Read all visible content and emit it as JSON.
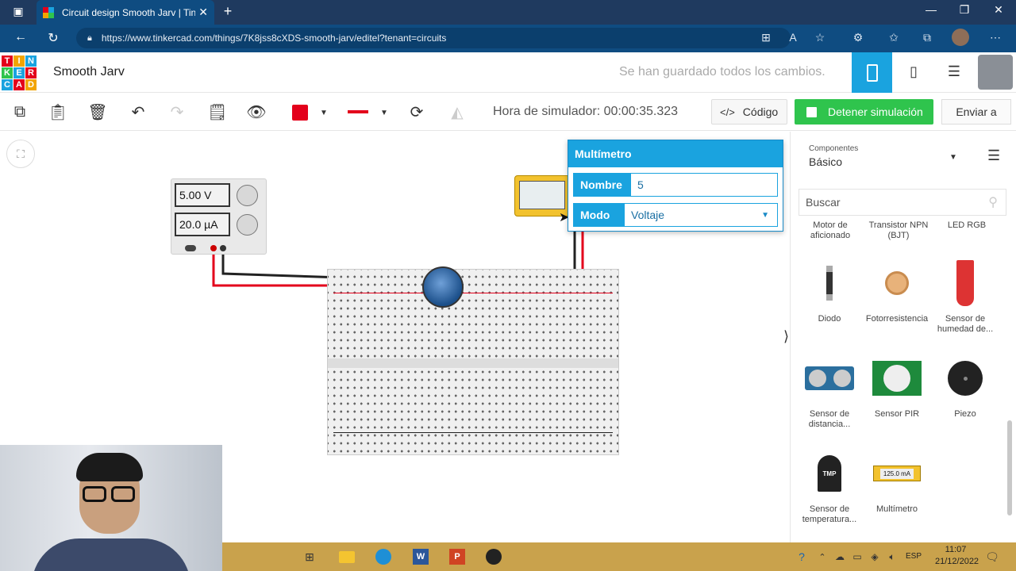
{
  "browser": {
    "tab_title": "Circuit design Smooth Jarv | Tinkercad",
    "url": "https://www.tinkercad.com/things/7K8jss8cXDS-smooth-jarv/editel?tenant=circuits"
  },
  "header": {
    "logo_letters": [
      "TIN",
      "KER",
      "CAD"
    ],
    "project_name": "Smooth Jarv",
    "save_status": "Se han guardado todos los cambios."
  },
  "toolbar": {
    "sim_time": "Hora de simulador: 00:00:35.323",
    "code_label": "Código",
    "stop_label": "Detener simulación",
    "send_label": "Enviar a",
    "wire_color": "#e3001b"
  },
  "power_supply": {
    "voltage": "5.00 V",
    "current": "20.0 µA"
  },
  "properties": {
    "title": "Multímetro",
    "name_label": "Nombre",
    "name_value": "5",
    "mode_label": "Modo",
    "mode_value": "Voltaje"
  },
  "components_panel": {
    "category_label": "Componentes",
    "category_value": "Básico",
    "search_placeholder": "Buscar",
    "partial_row": [
      "Motor de aficionado",
      "Transistor NPN (BJT)",
      "LED RGB"
    ],
    "items": [
      {
        "label": "Diodo"
      },
      {
        "label": "Fotorresistencia"
      },
      {
        "label": "Sensor de humedad de..."
      },
      {
        "label": "Sensor de distancia..."
      },
      {
        "label": "Sensor PIR"
      },
      {
        "label": "Piezo"
      },
      {
        "label": "Sensor de temperatura..."
      },
      {
        "label": "Multímetro",
        "readout": "125.0 mA"
      }
    ]
  },
  "taskbar": {
    "lang": "ESP",
    "time": "11:07",
    "date": "21/12/2022"
  }
}
